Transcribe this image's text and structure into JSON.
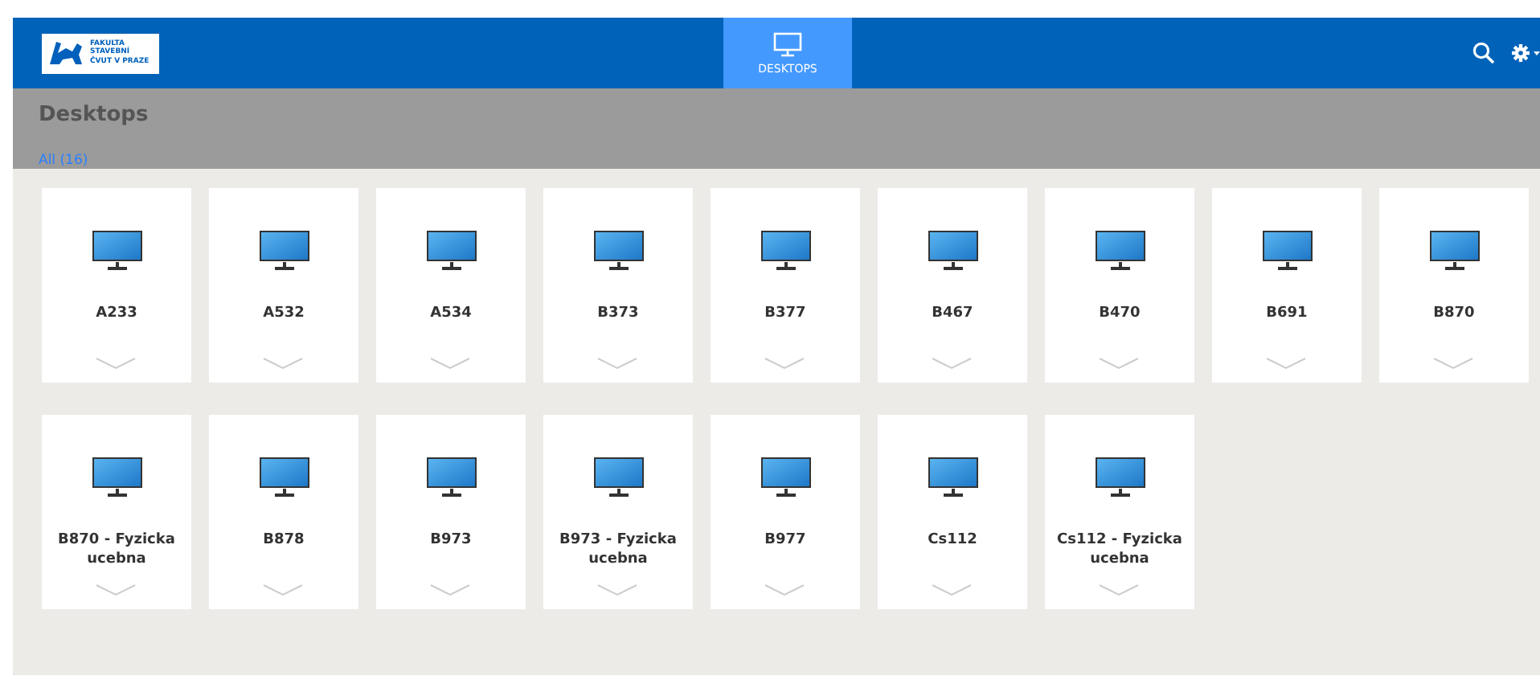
{
  "header": {
    "logo_lines": [
      "FAKULTA",
      "STAVEBNÍ",
      "ČVUT V PRAZE"
    ],
    "tabs": [
      {
        "label": "DESKTOPS",
        "selected": true
      }
    ]
  },
  "page": {
    "title": "Desktops",
    "filters": [
      {
        "label": "All (16)",
        "selected": true
      }
    ]
  },
  "desktops": [
    {
      "name": "A233"
    },
    {
      "name": "A532"
    },
    {
      "name": "A534"
    },
    {
      "name": "B373"
    },
    {
      "name": "B377"
    },
    {
      "name": "B467"
    },
    {
      "name": "B470"
    },
    {
      "name": "B691"
    },
    {
      "name": "B870"
    },
    {
      "name": "B870 - Fyzicka ucebna"
    },
    {
      "name": "B878"
    },
    {
      "name": "B973"
    },
    {
      "name": "B973 - Fyzicka ucebna"
    },
    {
      "name": "B977"
    },
    {
      "name": "Cs112"
    },
    {
      "name": "Cs112 - Fyzicka ucebna"
    }
  ]
}
